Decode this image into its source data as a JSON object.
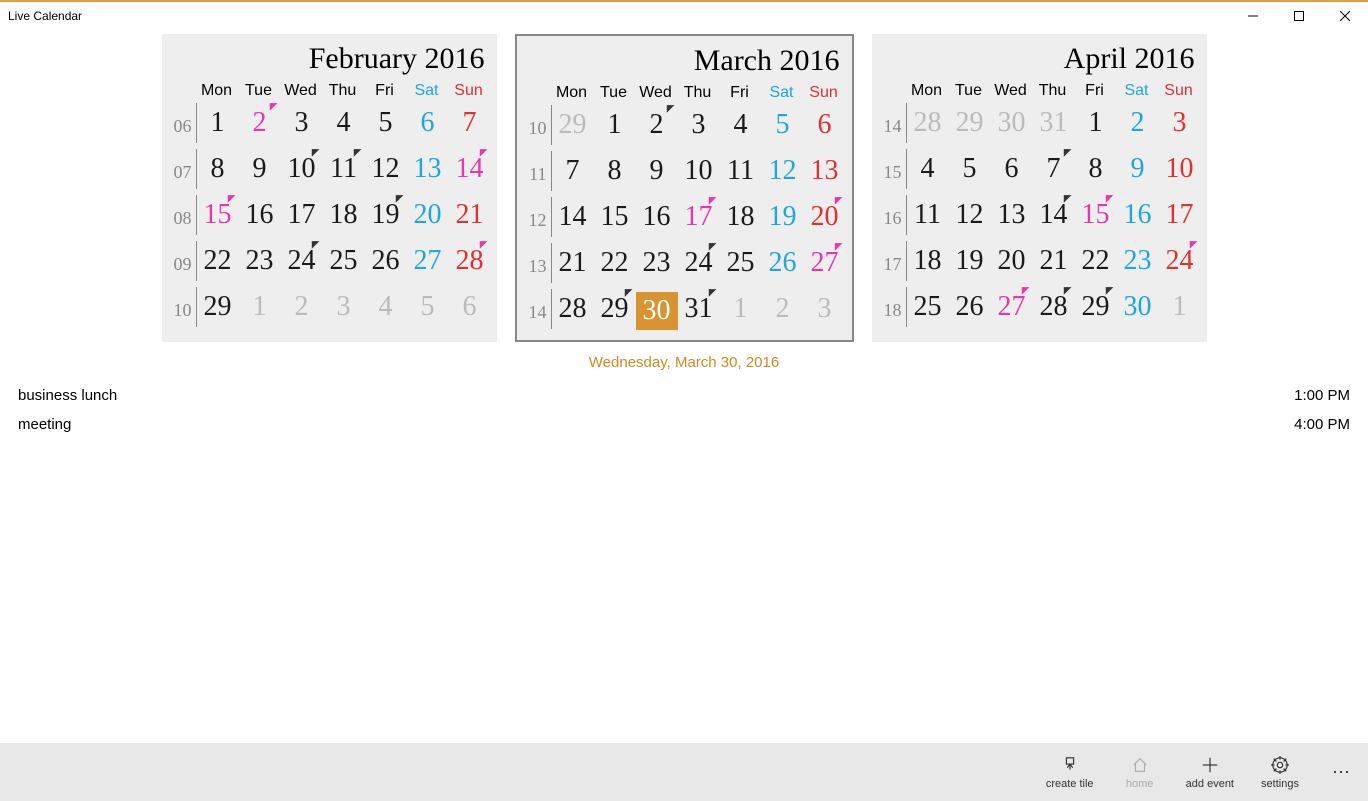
{
  "app_title": "Live Calendar",
  "dow_short": [
    "Mon",
    "Tue",
    "Wed",
    "Thu",
    "Fri",
    "Sat",
    "Sun"
  ],
  "months": [
    {
      "title": "February 2016",
      "current": false,
      "weeks": [
        {
          "num": "06",
          "days": [
            {
              "n": "1"
            },
            {
              "n": "2",
              "t": "p",
              "cls": "pink"
            },
            {
              "n": "3"
            },
            {
              "n": "4"
            },
            {
              "n": "5"
            },
            {
              "n": "6",
              "cls": "sat"
            },
            {
              "n": "7",
              "cls": "sun"
            }
          ]
        },
        {
          "num": "07",
          "days": [
            {
              "n": "8"
            },
            {
              "n": "9"
            },
            {
              "n": "10",
              "t": "k"
            },
            {
              "n": "11",
              "t": "k"
            },
            {
              "n": "12"
            },
            {
              "n": "13",
              "cls": "sat"
            },
            {
              "n": "14",
              "cls": "pink",
              "t": "p"
            }
          ]
        },
        {
          "num": "08",
          "days": [
            {
              "n": "15",
              "cls": "pink",
              "t": "p"
            },
            {
              "n": "16"
            },
            {
              "n": "17"
            },
            {
              "n": "18"
            },
            {
              "n": "19",
              "t": "k"
            },
            {
              "n": "20",
              "cls": "sat"
            },
            {
              "n": "21",
              "cls": "sun"
            }
          ]
        },
        {
          "num": "09",
          "days": [
            {
              "n": "22"
            },
            {
              "n": "23"
            },
            {
              "n": "24",
              "t": "k"
            },
            {
              "n": "25"
            },
            {
              "n": "26"
            },
            {
              "n": "27",
              "cls": "sat"
            },
            {
              "n": "28",
              "cls": "sun",
              "t": "p"
            }
          ]
        },
        {
          "num": "10",
          "days": [
            {
              "n": "29"
            },
            {
              "n": "1",
              "cls": "out"
            },
            {
              "n": "2",
              "cls": "out"
            },
            {
              "n": "3",
              "cls": "out"
            },
            {
              "n": "4",
              "cls": "out"
            },
            {
              "n": "5",
              "cls": "out"
            },
            {
              "n": "6",
              "cls": "out"
            }
          ]
        }
      ]
    },
    {
      "title": "March 2016",
      "current": true,
      "weeks": [
        {
          "num": "10",
          "days": [
            {
              "n": "29",
              "cls": "out"
            },
            {
              "n": "1"
            },
            {
              "n": "2",
              "t": "k"
            },
            {
              "n": "3"
            },
            {
              "n": "4"
            },
            {
              "n": "5",
              "cls": "sat"
            },
            {
              "n": "6",
              "cls": "sun"
            }
          ]
        },
        {
          "num": "11",
          "days": [
            {
              "n": "7"
            },
            {
              "n": "8"
            },
            {
              "n": "9"
            },
            {
              "n": "10"
            },
            {
              "n": "11"
            },
            {
              "n": "12",
              "cls": "sat"
            },
            {
              "n": "13",
              "cls": "sun"
            }
          ]
        },
        {
          "num": "12",
          "days": [
            {
              "n": "14"
            },
            {
              "n": "15"
            },
            {
              "n": "16"
            },
            {
              "n": "17",
              "cls": "pink",
              "t": "p"
            },
            {
              "n": "18"
            },
            {
              "n": "19",
              "cls": "sat"
            },
            {
              "n": "20",
              "cls": "sun",
              "t": "p"
            }
          ]
        },
        {
          "num": "13",
          "days": [
            {
              "n": "21"
            },
            {
              "n": "22"
            },
            {
              "n": "23"
            },
            {
              "n": "24",
              "t": "k"
            },
            {
              "n": "25"
            },
            {
              "n": "26",
              "cls": "sat"
            },
            {
              "n": "27",
              "cls": "pink",
              "t": "p"
            }
          ]
        },
        {
          "num": "14",
          "days": [
            {
              "n": "28"
            },
            {
              "n": "29",
              "t": "k"
            },
            {
              "n": "30",
              "today": true
            },
            {
              "n": "31",
              "t": "k"
            },
            {
              "n": "1",
              "cls": "out"
            },
            {
              "n": "2",
              "cls": "out"
            },
            {
              "n": "3",
              "cls": "out"
            }
          ]
        }
      ]
    },
    {
      "title": "April 2016",
      "current": false,
      "weeks": [
        {
          "num": "14",
          "days": [
            {
              "n": "28",
              "cls": "out"
            },
            {
              "n": "29",
              "cls": "out"
            },
            {
              "n": "30",
              "cls": "out"
            },
            {
              "n": "31",
              "cls": "out"
            },
            {
              "n": "1"
            },
            {
              "n": "2",
              "cls": "sat"
            },
            {
              "n": "3",
              "cls": "sun"
            }
          ]
        },
        {
          "num": "15",
          "days": [
            {
              "n": "4"
            },
            {
              "n": "5"
            },
            {
              "n": "6"
            },
            {
              "n": "7",
              "t": "k"
            },
            {
              "n": "8"
            },
            {
              "n": "9",
              "cls": "sat"
            },
            {
              "n": "10",
              "cls": "sun"
            }
          ]
        },
        {
          "num": "16",
          "days": [
            {
              "n": "11"
            },
            {
              "n": "12"
            },
            {
              "n": "13"
            },
            {
              "n": "14",
              "t": "k"
            },
            {
              "n": "15",
              "cls": "pink",
              "t": "p"
            },
            {
              "n": "16",
              "cls": "sat"
            },
            {
              "n": "17",
              "cls": "sun"
            }
          ]
        },
        {
          "num": "17",
          "days": [
            {
              "n": "18"
            },
            {
              "n": "19"
            },
            {
              "n": "20"
            },
            {
              "n": "21"
            },
            {
              "n": "22"
            },
            {
              "n": "23",
              "cls": "sat"
            },
            {
              "n": "24",
              "cls": "sun",
              "t": "p"
            }
          ]
        },
        {
          "num": "18",
          "days": [
            {
              "n": "25"
            },
            {
              "n": "26"
            },
            {
              "n": "27",
              "cls": "pink",
              "t": "p"
            },
            {
              "n": "28",
              "t": "k"
            },
            {
              "n": "29",
              "t": "k"
            },
            {
              "n": "30",
              "cls": "sat"
            },
            {
              "n": "1",
              "cls": "out"
            }
          ]
        }
      ]
    }
  ],
  "selected_date_label": "Wednesday, March 30, 2016",
  "events": [
    {
      "title": "business lunch",
      "time": "1:00 PM"
    },
    {
      "title": "meeting",
      "time": "4:00 PM"
    }
  ],
  "commands": {
    "create_tile": "create tile",
    "home": "home",
    "add_event": "add event",
    "settings": "settings"
  }
}
